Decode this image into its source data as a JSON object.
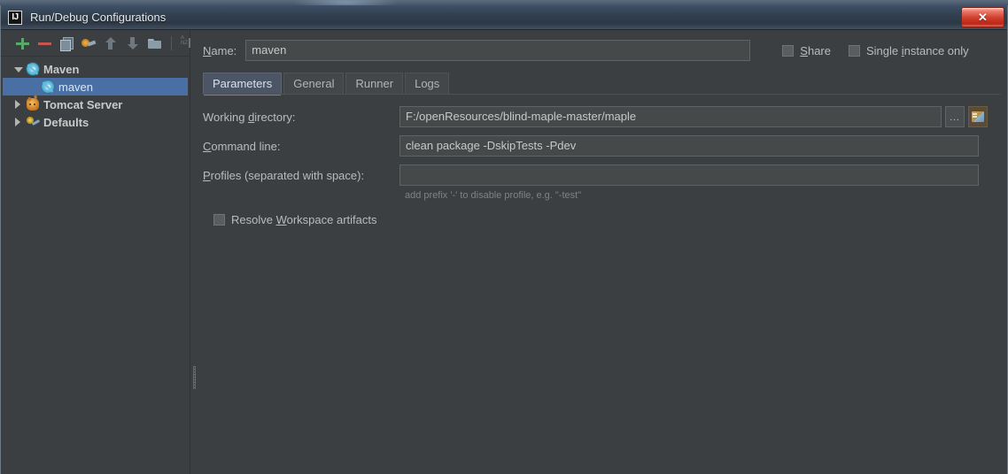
{
  "window": {
    "title": "Run/Debug Configurations",
    "logo_text": "IJ",
    "close_label": "✕"
  },
  "toolbar": {
    "items": [
      {
        "name": "add-configuration-button",
        "icon": "plus-icon",
        "enabled": true
      },
      {
        "name": "remove-configuration-button",
        "icon": "minus-icon",
        "enabled": true
      },
      {
        "name": "copy-configuration-button",
        "icon": "copy-icon",
        "enabled": true
      },
      {
        "name": "edit-templates-button",
        "icon": "wrench-icon",
        "enabled": true
      },
      {
        "name": "move-up-button",
        "icon": "arrow-up-icon",
        "enabled": false
      },
      {
        "name": "move-down-button",
        "icon": "arrow-down-icon",
        "enabled": false
      },
      {
        "name": "create-folder-button",
        "icon": "folder-icon",
        "enabled": true
      },
      {
        "name": "sort-configurations-button",
        "icon": "sort-alpha-icon",
        "enabled": false
      }
    ]
  },
  "tree": {
    "nodes": [
      {
        "label": "Maven",
        "icon": "maven-icon",
        "expanded": true,
        "selected": false,
        "level": 0
      },
      {
        "label": "maven",
        "icon": "maven-icon",
        "expanded": null,
        "selected": true,
        "level": 1
      },
      {
        "label": "Tomcat Server",
        "icon": "tomcat-icon",
        "expanded": false,
        "selected": false,
        "level": 0
      },
      {
        "label": "Defaults",
        "icon": "defaults-icon",
        "expanded": false,
        "selected": false,
        "level": 0
      }
    ]
  },
  "name_field": {
    "label_prefix": "",
    "label_mnemonic": "N",
    "label_suffix": "ame:",
    "value": "maven",
    "placeholder": ""
  },
  "options": {
    "share": {
      "label_prefix": "",
      "label_mnemonic": "S",
      "label_suffix": "hare",
      "checked": false
    },
    "single_instance": {
      "label_prefix": "Single ",
      "label_mnemonic": "i",
      "label_suffix": "nstance only",
      "checked": false
    }
  },
  "tabs": {
    "items": [
      {
        "label": "Parameters",
        "active": true
      },
      {
        "label": "General",
        "active": false
      },
      {
        "label": "Runner",
        "active": false
      },
      {
        "label": "Logs",
        "active": false
      }
    ]
  },
  "parameters": {
    "working_directory": {
      "label_prefix": "Working ",
      "label_mnemonic": "d",
      "label_suffix": "irectory:",
      "value": "F:/openResources/blind-maple-master/maple",
      "placeholder": "",
      "browse_button_label": "…",
      "module_button_icon": "module-folder-icon"
    },
    "command_line": {
      "label_prefix": "",
      "label_mnemonic": "C",
      "label_suffix": "ommand line:",
      "value": "clean package -DskipTests -Pdev",
      "placeholder": ""
    },
    "profiles": {
      "label_prefix": "",
      "label_mnemonic": "P",
      "label_suffix": "rofiles (separated with space):",
      "value": "",
      "placeholder": "",
      "hint": "add prefix '-' to disable profile, e.g. \"-test\""
    },
    "resolve_workspace_artifacts": {
      "label_prefix": "Resolve ",
      "label_mnemonic": "W",
      "label_suffix": "orkspace artifacts",
      "checked": false
    }
  },
  "colors": {
    "background": "#3c3f41",
    "field_background": "#45494a",
    "selection": "#4a6fa5",
    "accent_tab_underline": "#4a88c7",
    "text": "#bbbbbb",
    "hint_text": "#7e8285",
    "add_icon": "#59a869",
    "remove_icon": "#c75450"
  }
}
